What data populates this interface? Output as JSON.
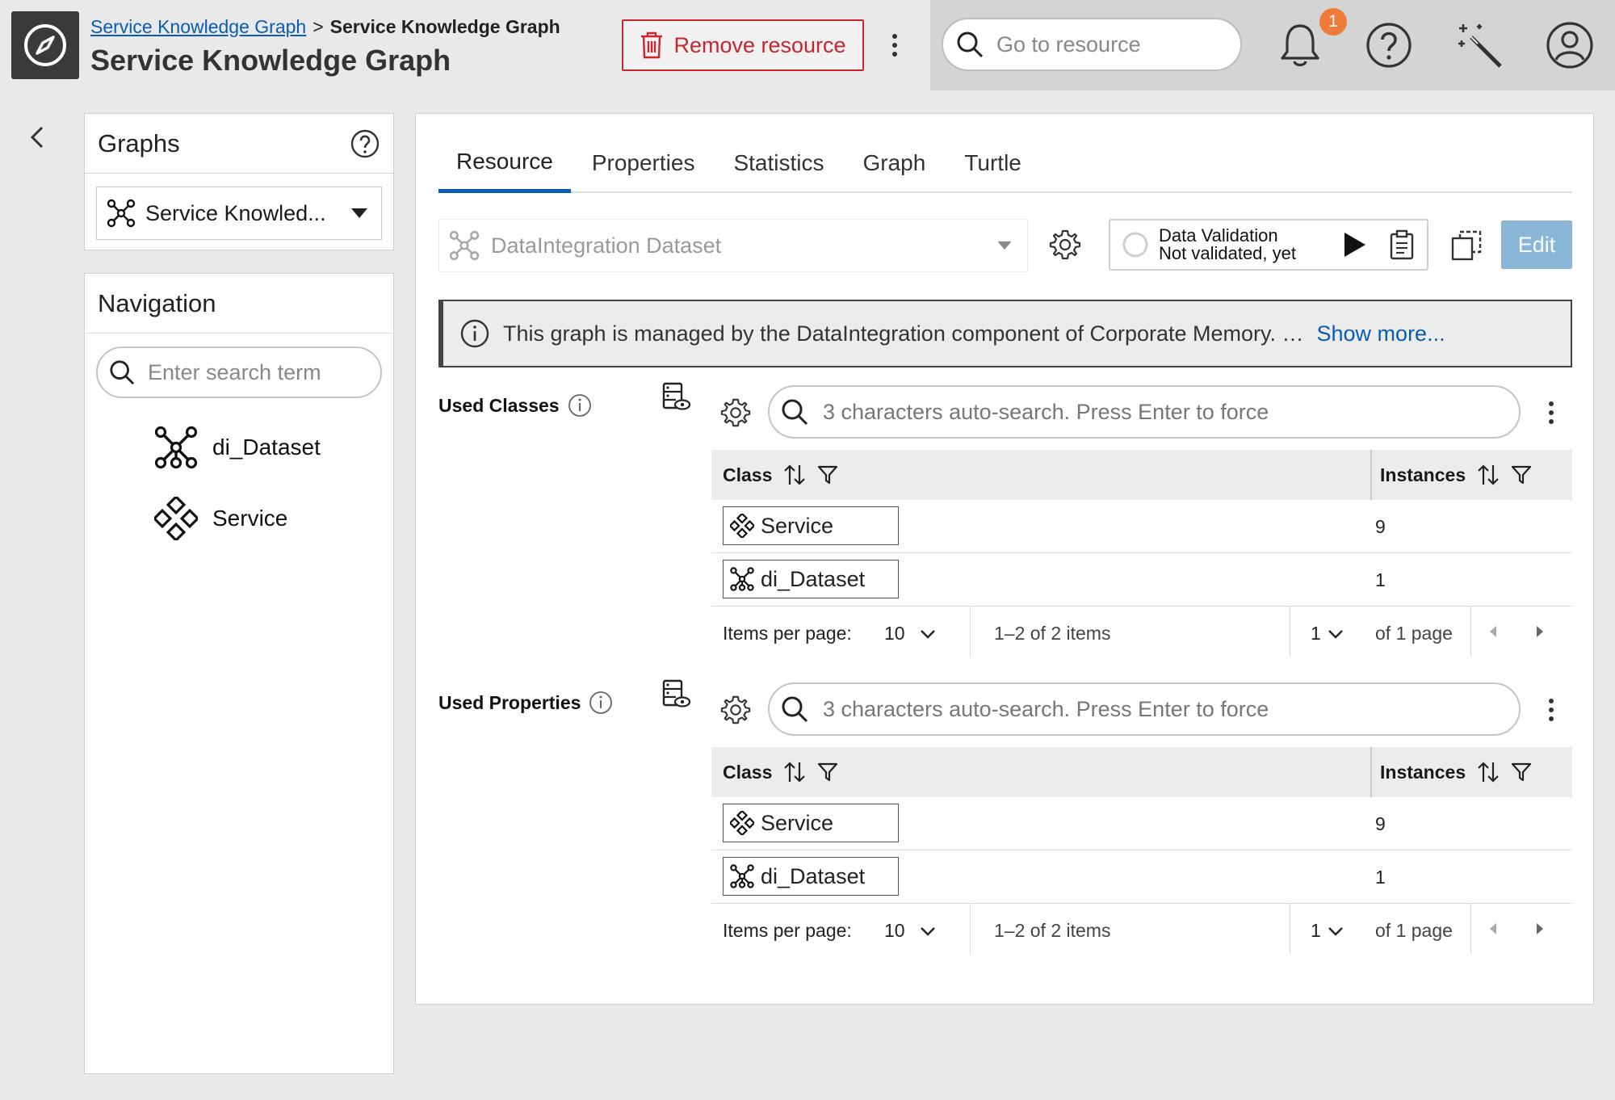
{
  "header": {
    "breadcrumb_link": "Service Knowledge Graph",
    "breadcrumb_sep": ">",
    "breadcrumb_current": "Service Knowledge Graph",
    "title": "Service Knowledge Graph",
    "remove_label": "Remove resource",
    "search_placeholder": "Go to resource",
    "notification_count": "1"
  },
  "graphs": {
    "title": "Graphs",
    "selected": "Service Knowled..."
  },
  "navigation": {
    "title": "Navigation",
    "search_placeholder": "Enter search term",
    "items": [
      {
        "label": "di_Dataset",
        "icon": "dataset-icon"
      },
      {
        "label": "Service",
        "icon": "service-icon"
      }
    ]
  },
  "tabs": [
    "Resource",
    "Properties",
    "Statistics",
    "Graph",
    "Turtle"
  ],
  "active_tab": "Resource",
  "resource": {
    "class_select": "DataIntegration Dataset",
    "validation_title": "Data Validation",
    "validation_status": "Not validated, yet",
    "edit_label": "Edit"
  },
  "info": {
    "text": "This graph is managed by the DataIntegration component of Corporate Memory. …",
    "more": "Show more..."
  },
  "sections": [
    {
      "label": "Used Classes",
      "search_placeholder": "3 characters auto-search. Press Enter to force",
      "col_class": "Class",
      "col_instances": "Instances",
      "rows": [
        {
          "name": "Service",
          "icon": "service-icon",
          "count": "9"
        },
        {
          "name": "di_Dataset",
          "icon": "dataset-icon",
          "count": "1"
        }
      ],
      "pager": {
        "items_per_page_label": "Items per page:",
        "items_per_page": "10",
        "range": "1–2 of 2 items",
        "page": "1",
        "of_pages": "of 1 page"
      }
    },
    {
      "label": "Used Properties",
      "search_placeholder": "3 characters auto-search. Press Enter to force",
      "col_class": "Class",
      "col_instances": "Instances",
      "rows": [
        {
          "name": "Service",
          "icon": "service-icon",
          "count": "9"
        },
        {
          "name": "di_Dataset",
          "icon": "dataset-icon",
          "count": "1"
        }
      ],
      "pager": {
        "items_per_page_label": "Items per page:",
        "items_per_page": "10",
        "range": "1–2 of 2 items",
        "page": "1",
        "of_pages": "of 1 page"
      }
    }
  ],
  "colors": {
    "accent": "#0a5db5",
    "danger": "#c6262e",
    "badge": "#f07a3a",
    "edit_disabled": "#8ab7d8"
  }
}
